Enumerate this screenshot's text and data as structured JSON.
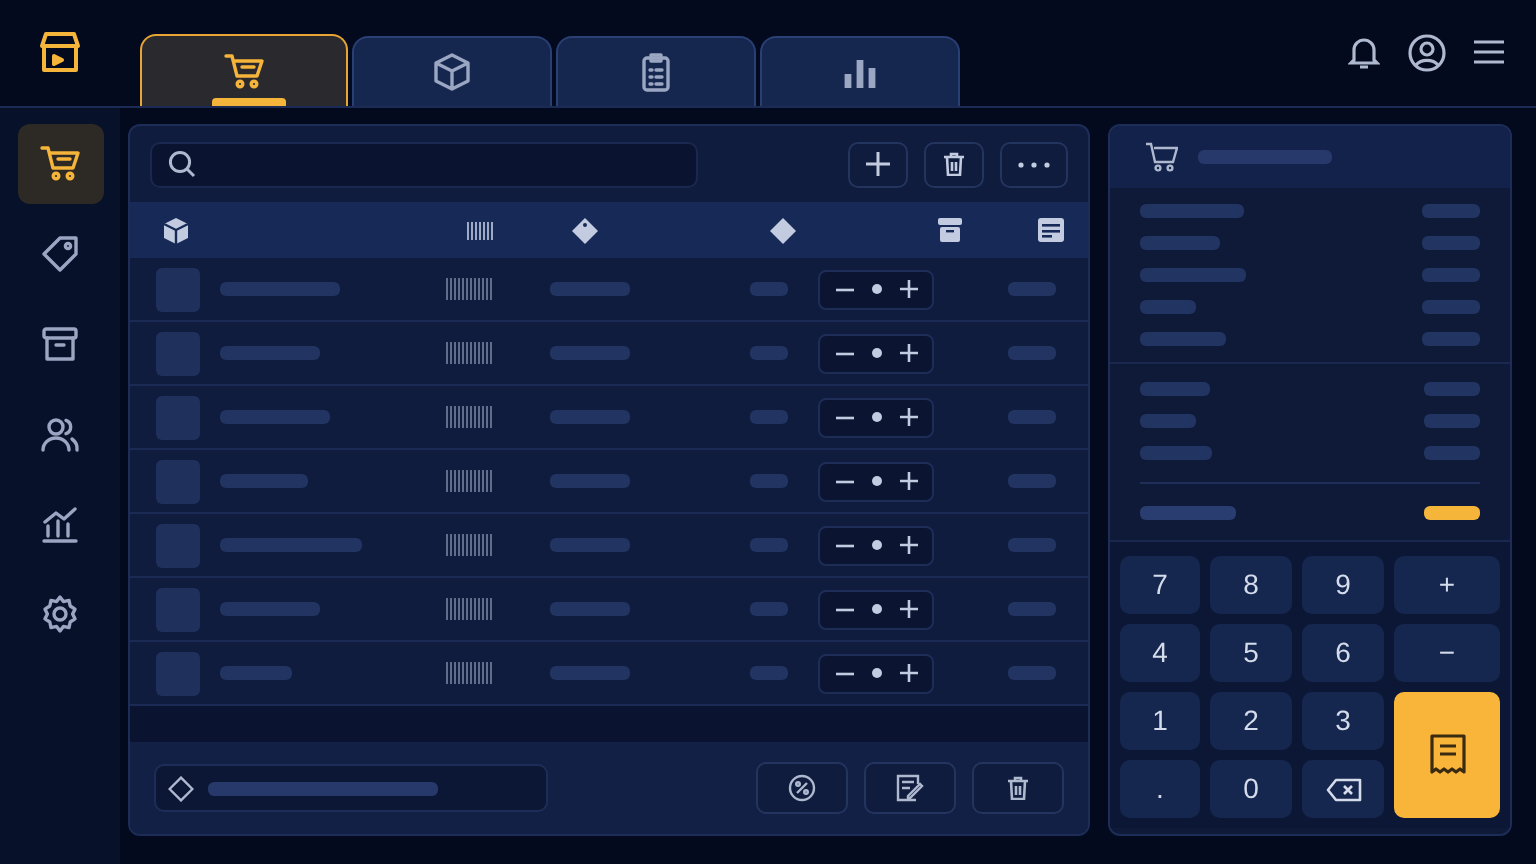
{
  "tabs": [
    {
      "kind": "cart",
      "selected": true
    },
    {
      "kind": "box",
      "selected": false
    },
    {
      "kind": "clipboard",
      "selected": false
    },
    {
      "kind": "chart",
      "selected": false
    }
  ],
  "sidebar": {
    "items": [
      {
        "kind": "cart",
        "selected": true
      },
      {
        "kind": "tag",
        "selected": false
      },
      {
        "kind": "archive",
        "selected": false
      },
      {
        "kind": "users",
        "selected": false
      },
      {
        "kind": "chart",
        "selected": false
      },
      {
        "kind": "gear",
        "selected": false
      }
    ]
  },
  "table": {
    "rows": [
      {
        "kind": "skeleton"
      },
      {
        "kind": "skeleton"
      },
      {
        "kind": "skeleton"
      },
      {
        "kind": "skeleton"
      },
      {
        "kind": "skeleton"
      },
      {
        "kind": "skeleton"
      },
      {
        "kind": "skeleton"
      }
    ]
  },
  "keypad": [
    {
      "kind": "key",
      "label": "7"
    },
    {
      "kind": "key",
      "label": "8"
    },
    {
      "kind": "key",
      "label": "9"
    },
    {
      "kind": "key",
      "label": "+"
    },
    {
      "kind": "key",
      "label": "4"
    },
    {
      "kind": "key",
      "label": "5"
    },
    {
      "kind": "key",
      "label": "6"
    },
    {
      "kind": "key",
      "label": "−"
    },
    {
      "kind": "key",
      "label": "1"
    },
    {
      "kind": "key",
      "label": "2"
    },
    {
      "kind": "key",
      "label": "3"
    },
    {
      "kind": "enter"
    },
    {
      "kind": "key",
      "label": "."
    },
    {
      "kind": "key",
      "label": "0"
    },
    {
      "kind": "backspace"
    }
  ]
}
